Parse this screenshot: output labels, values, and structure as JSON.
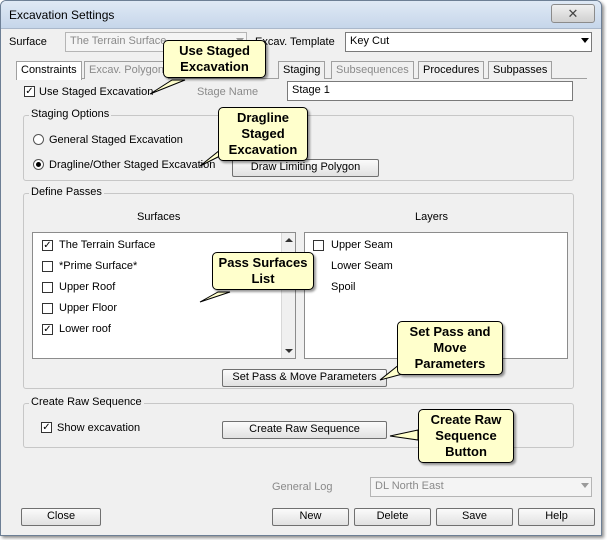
{
  "window": {
    "title": "Excavation Settings",
    "close_glyph": "✕"
  },
  "header": {
    "surface_label": "Surface",
    "surface_value": "The Terrain Surface",
    "template_label": "Excav. Template",
    "template_value": "Key Cut"
  },
  "tabs": [
    "Constraints",
    "Excav. Polygon",
    "Staging",
    "Subsequences",
    "Procedures",
    "Subpasses"
  ],
  "use_staged": {
    "label": "Use Staged Excavation",
    "checked": true
  },
  "stage_name": {
    "label": "Stage Name",
    "value": "Stage 1"
  },
  "staging_options": {
    "title": "Staging Options",
    "general": "General Staged Excavation",
    "dragline": "Dragline/Other Staged Excavation",
    "draw_polygon": "Draw Limiting Polygon"
  },
  "define_passes": {
    "title": "Define Passes",
    "surfaces_header": "Surfaces",
    "layers_header": "Layers",
    "surfaces": [
      {
        "label": "The Terrain Surface",
        "checked": true
      },
      {
        "label": "*Prime Surface*",
        "checked": false
      },
      {
        "label": "Upper Roof",
        "checked": false
      },
      {
        "label": "Upper Floor",
        "checked": false
      },
      {
        "label": "Lower roof",
        "checked": true
      }
    ],
    "layers": [
      {
        "label": "Upper Seam",
        "checked": false
      },
      {
        "label": "Lower Seam",
        "checked": false
      },
      {
        "label": "Spoil",
        "checked": false
      }
    ],
    "set_pass_button": "Set Pass & Move Parameters"
  },
  "raw_sequence": {
    "title": "Create Raw Sequence",
    "show_excavation": "Show excavation",
    "create_button": "Create Raw Sequence"
  },
  "general_log": {
    "label": "General Log",
    "value": "DL North East"
  },
  "footer": {
    "close": "Close",
    "new": "New",
    "delete": "Delete",
    "save": "Save",
    "help": "Help"
  },
  "callouts": {
    "use_staged": "Use Staged Excavation",
    "dragline": "Dragline Staged Excavation",
    "pass_surfaces": "Pass Surfaces List",
    "set_pass": "Set Pass and Move Parameters",
    "create_raw": "Create Raw Sequence Button"
  },
  "colors": {
    "callout_bg": "#ffffcc",
    "title_bar": "#c6d6ea"
  }
}
